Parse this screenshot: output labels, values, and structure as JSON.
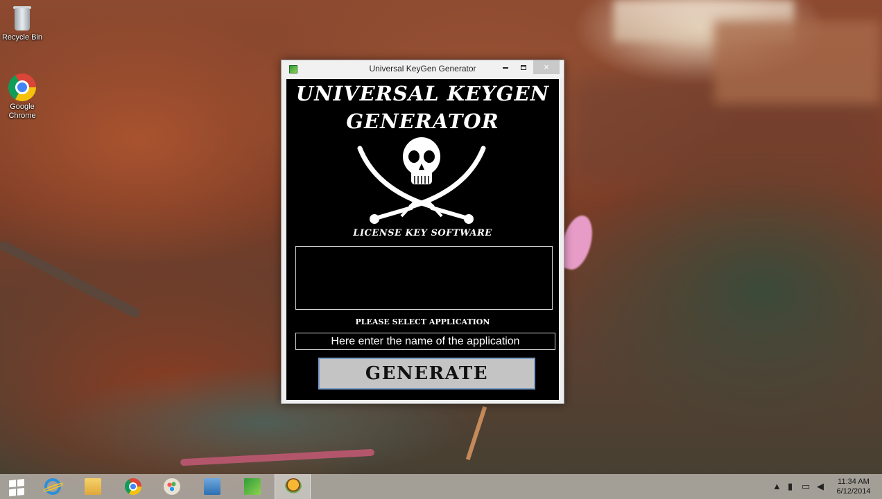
{
  "desktop": {
    "icons": [
      {
        "label": "Recycle Bin",
        "icon": "recycle-bin-icon"
      },
      {
        "label": "Google Chrome",
        "icon": "chrome-icon"
      }
    ]
  },
  "window": {
    "title": "Universal KeyGen Generator",
    "controls": {
      "minimize": "–",
      "maximize": "□",
      "close": "×"
    },
    "logo_line1": "UNIVERSAL KEYGEN",
    "logo_line2": "GENERATOR",
    "logo_icon": "skull-crossed-swords-icon",
    "tagline": "LICENSE KEY SOFTWARE",
    "output_value": "",
    "select_label": "PLEASE SELECT APPLICATION",
    "app_input": {
      "value": "",
      "placeholder": "Here enter the name of the application"
    },
    "generate_label": "GENERATE"
  },
  "taskbar": {
    "items": [
      {
        "name": "start",
        "icon": "windows-logo-icon"
      },
      {
        "name": "internet-explorer",
        "icon": "internet-explorer-icon"
      },
      {
        "name": "file-explorer",
        "icon": "folder-icon"
      },
      {
        "name": "chrome",
        "icon": "chrome-icon"
      },
      {
        "name": "paint",
        "icon": "paint-palette-icon"
      },
      {
        "name": "remote-desktop",
        "icon": "monitor-icon"
      },
      {
        "name": "keygen",
        "icon": "keygen-app-icon"
      },
      {
        "name": "burger-app",
        "icon": "burger-icon",
        "active": true
      }
    ],
    "tray": {
      "icons": [
        "show-hidden-icons-icon",
        "power-icon",
        "network-icon",
        "volume-icon"
      ],
      "time": "11:34 AM",
      "date": "6/12/2014"
    }
  },
  "colors": {
    "window_bg": "#000000",
    "button_bg": "#c4c4c4",
    "button_border": "#7a9dc8",
    "text": "#ffffff"
  }
}
